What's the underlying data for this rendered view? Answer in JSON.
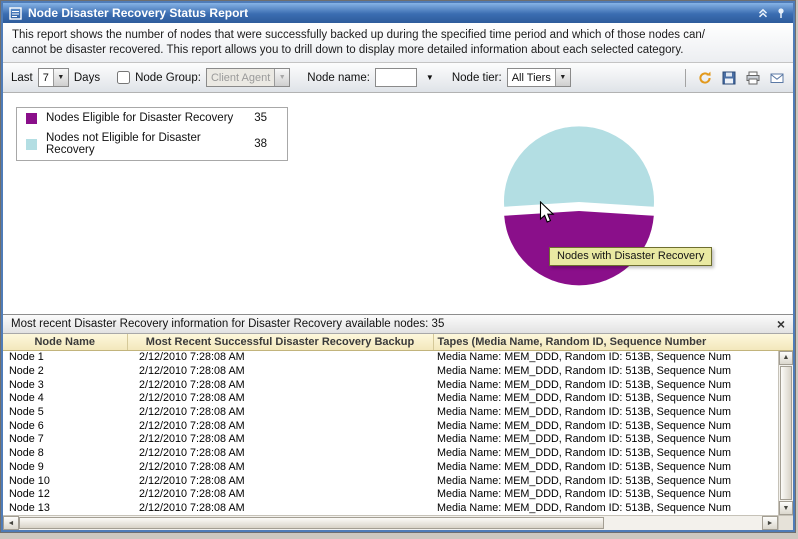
{
  "titlebar": {
    "title": "Node Disaster Recovery Status Report"
  },
  "description_lines": [
    "This report shows the number of nodes that were successfully backed up during the specified time period and which of those nodes can/",
    "cannot be disaster recovered. This report allows you to drill down to display more detailed information about each selected category."
  ],
  "filters": {
    "last_label": "Last",
    "period_value": "7",
    "days_label": "Days",
    "node_group_label": "Node Group:",
    "node_group_value": "Client Agent",
    "node_name_label": "Node name:",
    "node_name_value": "",
    "node_tier_label": "Node tier:",
    "node_tier_value": "All Tiers",
    "action_icons": [
      "refresh-icon",
      "save-icon",
      "print-icon",
      "email-icon"
    ]
  },
  "chart_data": {
    "type": "pie",
    "slices": [
      {
        "label": "Nodes Eligible for Disaster Recovery",
        "value": 35,
        "color": "#8A0F8A",
        "exploded": false
      },
      {
        "label": "Nodes not Eligible for Disaster Recovery",
        "value": 38,
        "color": "#B3DEE3",
        "exploded": true
      }
    ],
    "legend_position": "top-left",
    "tooltip": "Nodes with Disaster Recovery"
  },
  "detail": {
    "header": "Most recent Disaster Recovery information for Disaster Recovery available nodes: 35",
    "columns": [
      "Node Name",
      "Most Recent Successful Disaster Recovery Backup",
      "Tapes (Media Name, Random ID, Sequence Number"
    ],
    "rows": [
      {
        "name": "Node 1",
        "backup": "2/12/2010 7:28:08 AM",
        "tapes": "Media Name: MEM_DDD, Random ID: 513B, Sequence Num"
      },
      {
        "name": "Node 2",
        "backup": "2/12/2010 7:28:08 AM",
        "tapes": "Media Name: MEM_DDD, Random ID: 513B, Sequence Num"
      },
      {
        "name": "Node 3",
        "backup": "2/12/2010 7:28:08 AM",
        "tapes": "Media Name: MEM_DDD, Random ID: 513B, Sequence Num"
      },
      {
        "name": "Node 4",
        "backup": "2/12/2010 7:28:08 AM",
        "tapes": "Media Name: MEM_DDD, Random ID: 513B, Sequence Num"
      },
      {
        "name": "Node 5",
        "backup": "2/12/2010 7:28:08 AM",
        "tapes": "Media Name: MEM_DDD, Random ID: 513B, Sequence Num"
      },
      {
        "name": "Node 6",
        "backup": "2/12/2010 7:28:08 AM",
        "tapes": "Media Name: MEM_DDD, Random ID: 513B, Sequence Num"
      },
      {
        "name": "Node 7",
        "backup": "2/12/2010 7:28:08 AM",
        "tapes": "Media Name: MEM_DDD, Random ID: 513B, Sequence Num"
      },
      {
        "name": "Node 8",
        "backup": "2/12/2010 7:28:08 AM",
        "tapes": "Media Name: MEM_DDD, Random ID: 513B, Sequence Num"
      },
      {
        "name": "Node 9",
        "backup": "2/12/2010 7:28:08 AM",
        "tapes": "Media Name: MEM_DDD, Random ID: 513B, Sequence Num"
      },
      {
        "name": "Node 10",
        "backup": "2/12/2010 7:28:08 AM",
        "tapes": "Media Name: MEM_DDD, Random ID: 513B, Sequence Num"
      },
      {
        "name": "Node 12",
        "backup": "2/12/2010 7:28:08 AM",
        "tapes": "Media Name: MEM_DDD, Random ID: 513B, Sequence Num"
      },
      {
        "name": "Node 13",
        "backup": "2/12/2010 7:28:08 AM",
        "tapes": "Media Name: MEM_DDD, Random ID: 513B, Sequence Num"
      }
    ]
  },
  "glyphs": {
    "dropdown": "▼",
    "scroll_up": "▲",
    "scroll_down": "▼",
    "scroll_left": "◄",
    "scroll_right": "►",
    "close": "×"
  }
}
